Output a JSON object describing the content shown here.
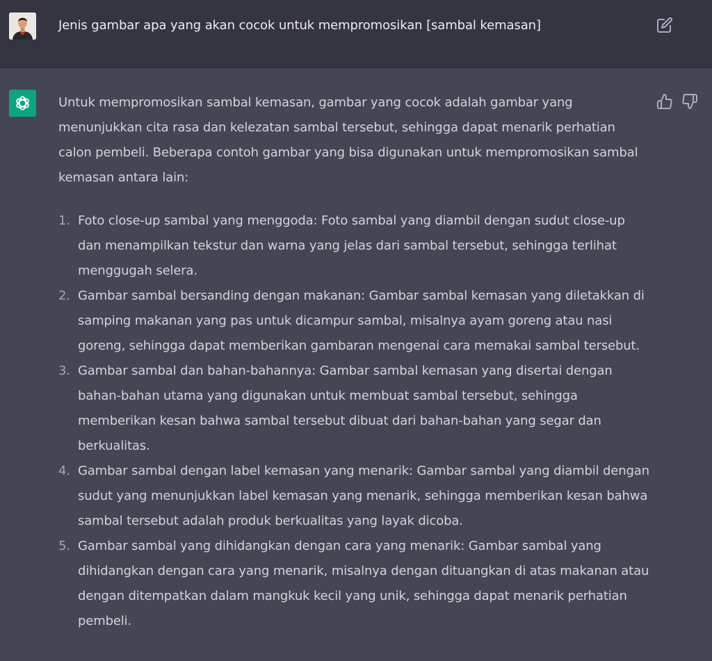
{
  "user_message": {
    "text": "Jenis gambar apa yang akan cocok untuk mempromosikan [sambal kemasan]",
    "avatar_icon": "user-photo-avatar",
    "edit_icon": "edit-pencil-icon"
  },
  "assistant_message": {
    "avatar_icon": "openai-logo-icon",
    "avatar_color": "#10a37f",
    "feedback": {
      "up_icon": "thumbs-up-icon",
      "down_icon": "thumbs-down-icon"
    },
    "intro": "Untuk mempromosikan sambal kemasan, gambar yang cocok adalah gambar yang menunjukkan cita rasa dan kelezatan sambal tersebut, sehingga dapat menarik perhatian calon pembeli. Beberapa contoh gambar yang bisa digunakan untuk mempromosikan sambal kemasan antara lain:",
    "items": [
      {
        "number": "1.",
        "text": "Foto close-up sambal yang menggoda: Foto sambal yang diambil dengan sudut close-up dan menampilkan tekstur dan warna yang jelas dari sambal tersebut, sehingga terlihat menggugah selera."
      },
      {
        "number": "2.",
        "text": "Gambar sambal bersanding dengan makanan: Gambar sambal kemasan yang diletakkan di samping makanan yang pas untuk dicampur sambal, misalnya ayam goreng atau nasi goreng, sehingga dapat memberikan gambaran mengenai cara memakai sambal tersebut."
      },
      {
        "number": "3.",
        "text": "Gambar sambal dan bahan-bahannya: Gambar sambal kemasan yang disertai dengan bahan-bahan utama yang digunakan untuk membuat sambal tersebut, sehingga memberikan kesan bahwa sambal tersebut dibuat dari bahan-bahan yang segar dan berkualitas."
      },
      {
        "number": "4.",
        "text": "Gambar sambal dengan label kemasan yang menarik: Gambar sambal yang diambil dengan sudut yang menunjukkan label kemasan yang menarik, sehingga memberikan kesan bahwa sambal tersebut adalah produk berkualitas yang layak dicoba."
      },
      {
        "number": "5.",
        "text": "Gambar sambal yang dihidangkan dengan cara yang menarik: Gambar sambal yang dihidangkan dengan cara yang menarik, misalnya dengan dituangkan di atas makanan atau dengan ditempatkan dalam mangkuk kecil yang unik, sehingga dapat menarik perhatian pembeli."
      }
    ]
  }
}
